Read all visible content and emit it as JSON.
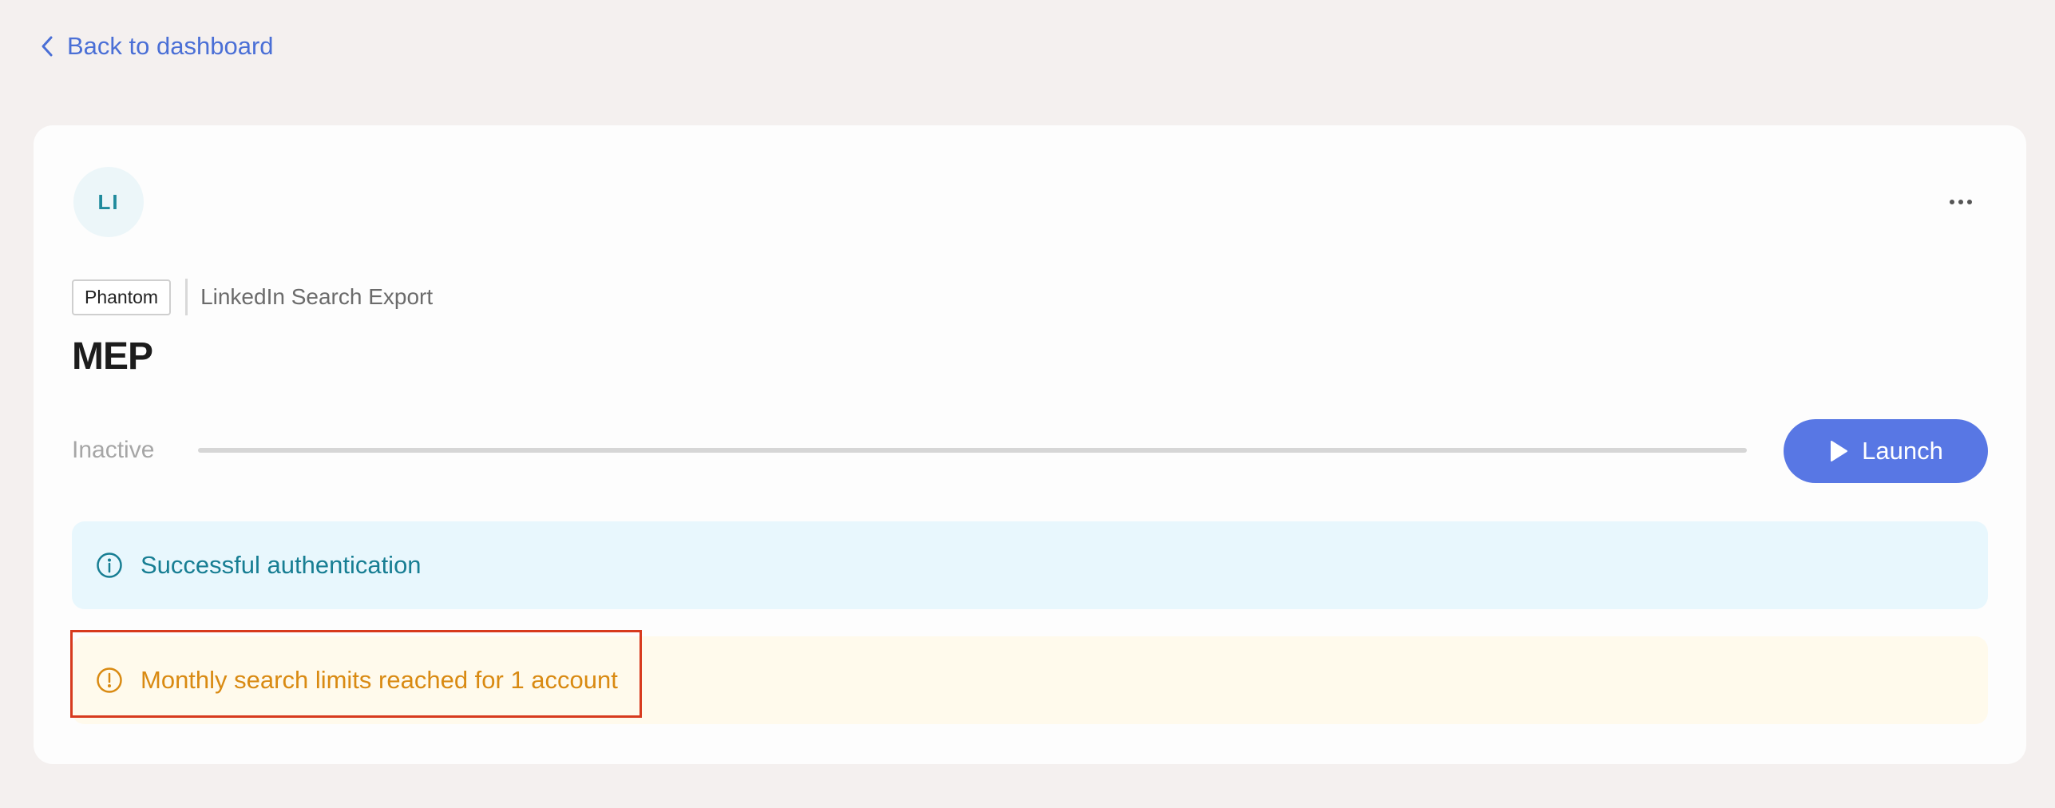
{
  "nav": {
    "back_label": "Back to dashboard"
  },
  "card": {
    "avatar_initials": "LI",
    "tag": "Phantom",
    "automation_name": "LinkedIn Search Export",
    "title": "MEP",
    "status": {
      "label": "Inactive",
      "progress": 0
    },
    "launch_label": "Launch",
    "alerts": {
      "info": "Successful authentication",
      "warning": "Monthly search limits reached for 1 account"
    }
  },
  "colors": {
    "accent": "#5877e4",
    "info": "#177e93",
    "warning": "#d98a12",
    "highlight": "#d73a1e"
  },
  "icons": {
    "back": "chevron-left-icon",
    "more": "more-horizontal-icon",
    "launch": "play-icon",
    "info": "info-icon",
    "warning": "warning-icon"
  }
}
